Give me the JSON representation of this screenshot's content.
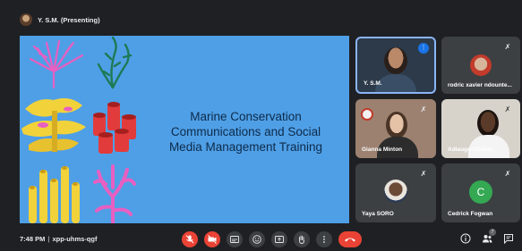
{
  "presenter": {
    "label": "Y. S.M. (Presenting)"
  },
  "slide": {
    "title_lines": [
      "Marine Conservation",
      "Communications and Social",
      "Media Management Training"
    ]
  },
  "participants": [
    {
      "name": "Y. S.M."
    },
    {
      "name": "rodric xavier ndounte..."
    },
    {
      "name": "Gianna Minton"
    },
    {
      "name": "Adiaugo Obienu"
    },
    {
      "name": "Yaya SORO"
    },
    {
      "name": "Cedrick Fogwan",
      "initial": "C"
    }
  ],
  "meeting": {
    "time": "7:48 PM",
    "separator": "|",
    "code": "xpp-uhms-qgf"
  },
  "people_count": "7",
  "colors": {
    "background": "#1f2023",
    "slide_background": "#4f9fe6",
    "active_border": "#8ab4f8",
    "danger": "#ea4335",
    "avatar_green": "#34a853"
  }
}
